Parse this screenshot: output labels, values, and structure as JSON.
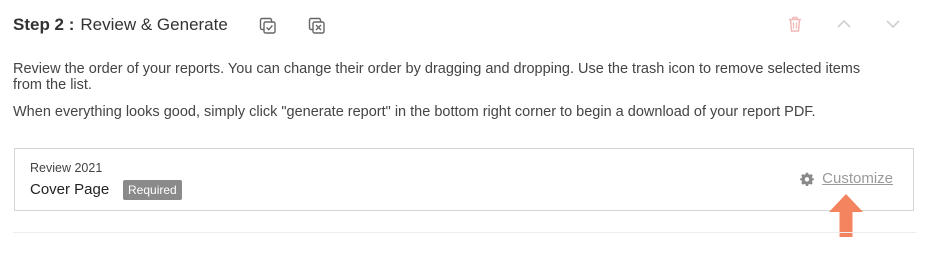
{
  "header": {
    "step_number": "Step 2 :",
    "title": "Review & Generate"
  },
  "icons": {
    "select_all": "checkbox-copy-icon",
    "deselect_all": "close-copy-icon",
    "delete": "trash-icon",
    "move_up": "chevron-up-icon",
    "move_down": "chevron-down-icon",
    "settings": "gear-icon",
    "pointer": "arrow-up-icon"
  },
  "instructions": {
    "line1": "Review the order of your reports. You can change their order by dragging and dropping. Use the trash icon to remove selected items from the list.",
    "line2": "When everything looks good, simply click \"generate report\" in the bottom right corner to begin a download of your report PDF."
  },
  "report_item": {
    "subtitle": "Review 2021",
    "title": "Cover Page",
    "badge": "Required",
    "customize_label": "Customize"
  },
  "colors": {
    "accent_arrow": "#f4845f",
    "badge_bg": "#8a8a8a",
    "trash_icon": "#f2b8b8",
    "chevron_icon": "#d0d0d0"
  }
}
